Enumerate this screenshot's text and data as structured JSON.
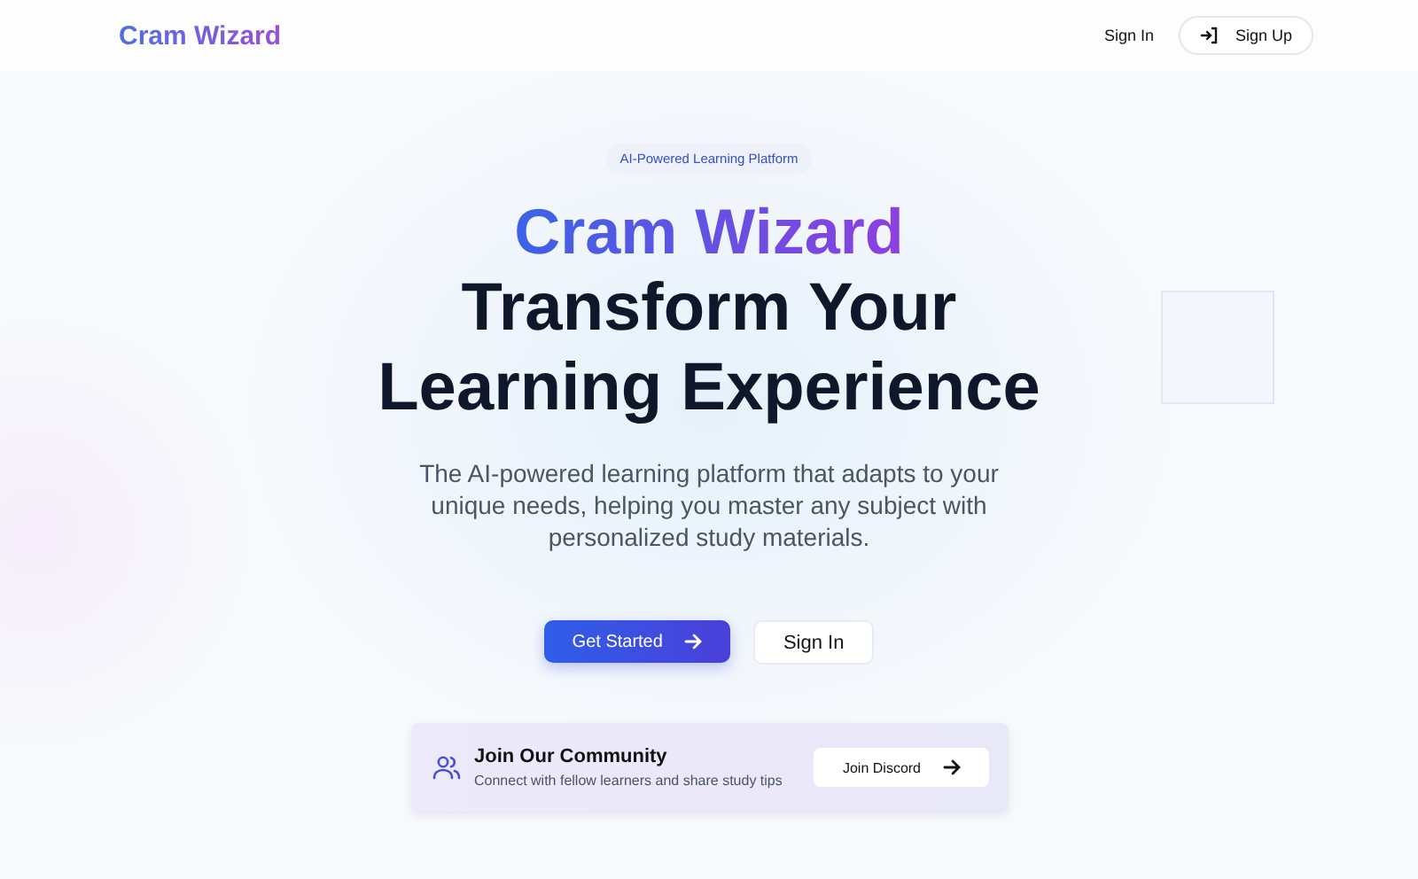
{
  "header": {
    "logo": "Cram Wizard",
    "sign_in": "Sign In",
    "sign_up": "Sign Up"
  },
  "hero": {
    "badge": "AI-Powered Learning Platform",
    "brand": "Cram Wizard",
    "headline": "Transform Your Learning Experience",
    "description": "The AI-powered learning platform that adapts to your unique needs, helping you master any subject with personalized study materials.",
    "primary_button": "Get Started",
    "secondary_button": "Sign In"
  },
  "community": {
    "title": "Join Our Community",
    "subtitle": "Connect with fellow learners and share study tips",
    "button": "Join Discord"
  }
}
